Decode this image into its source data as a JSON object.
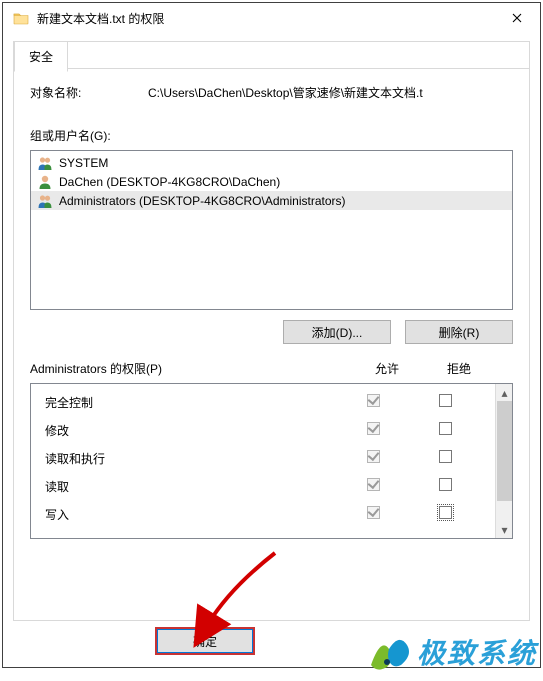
{
  "window": {
    "title": "新建文本文档.txt 的权限",
    "close": "✕"
  },
  "tab": {
    "label": "安全"
  },
  "objectName": {
    "label": "对象名称:",
    "path": "C:\\Users\\DaChen\\Desktop\\管家速修\\新建文本文档.t"
  },
  "groups": {
    "label": "组或用户名(G):",
    "items": [
      {
        "icon": "users",
        "text": "SYSTEM"
      },
      {
        "icon": "user",
        "text": "DaChen (DESKTOP-4KG8CRO\\DaChen)"
      },
      {
        "icon": "users",
        "text": "Administrators (DESKTOP-4KG8CRO\\Administrators)",
        "selected": true
      }
    ]
  },
  "buttons": {
    "add": "添加(D)...",
    "remove": "删除(R)",
    "ok": "确定"
  },
  "permHeader": {
    "label": "Administrators 的权限(P)",
    "allow": "允许",
    "deny": "拒绝"
  },
  "permissions": [
    {
      "name": "完全控制",
      "allow": true,
      "deny": false
    },
    {
      "name": "修改",
      "allow": true,
      "deny": false
    },
    {
      "name": "读取和执行",
      "allow": true,
      "deny": false
    },
    {
      "name": "读取",
      "allow": true,
      "deny": false
    },
    {
      "name": "写入",
      "allow": true,
      "deny": false,
      "denyFocus": true
    }
  ],
  "watermark": {
    "text": "极致系统"
  }
}
